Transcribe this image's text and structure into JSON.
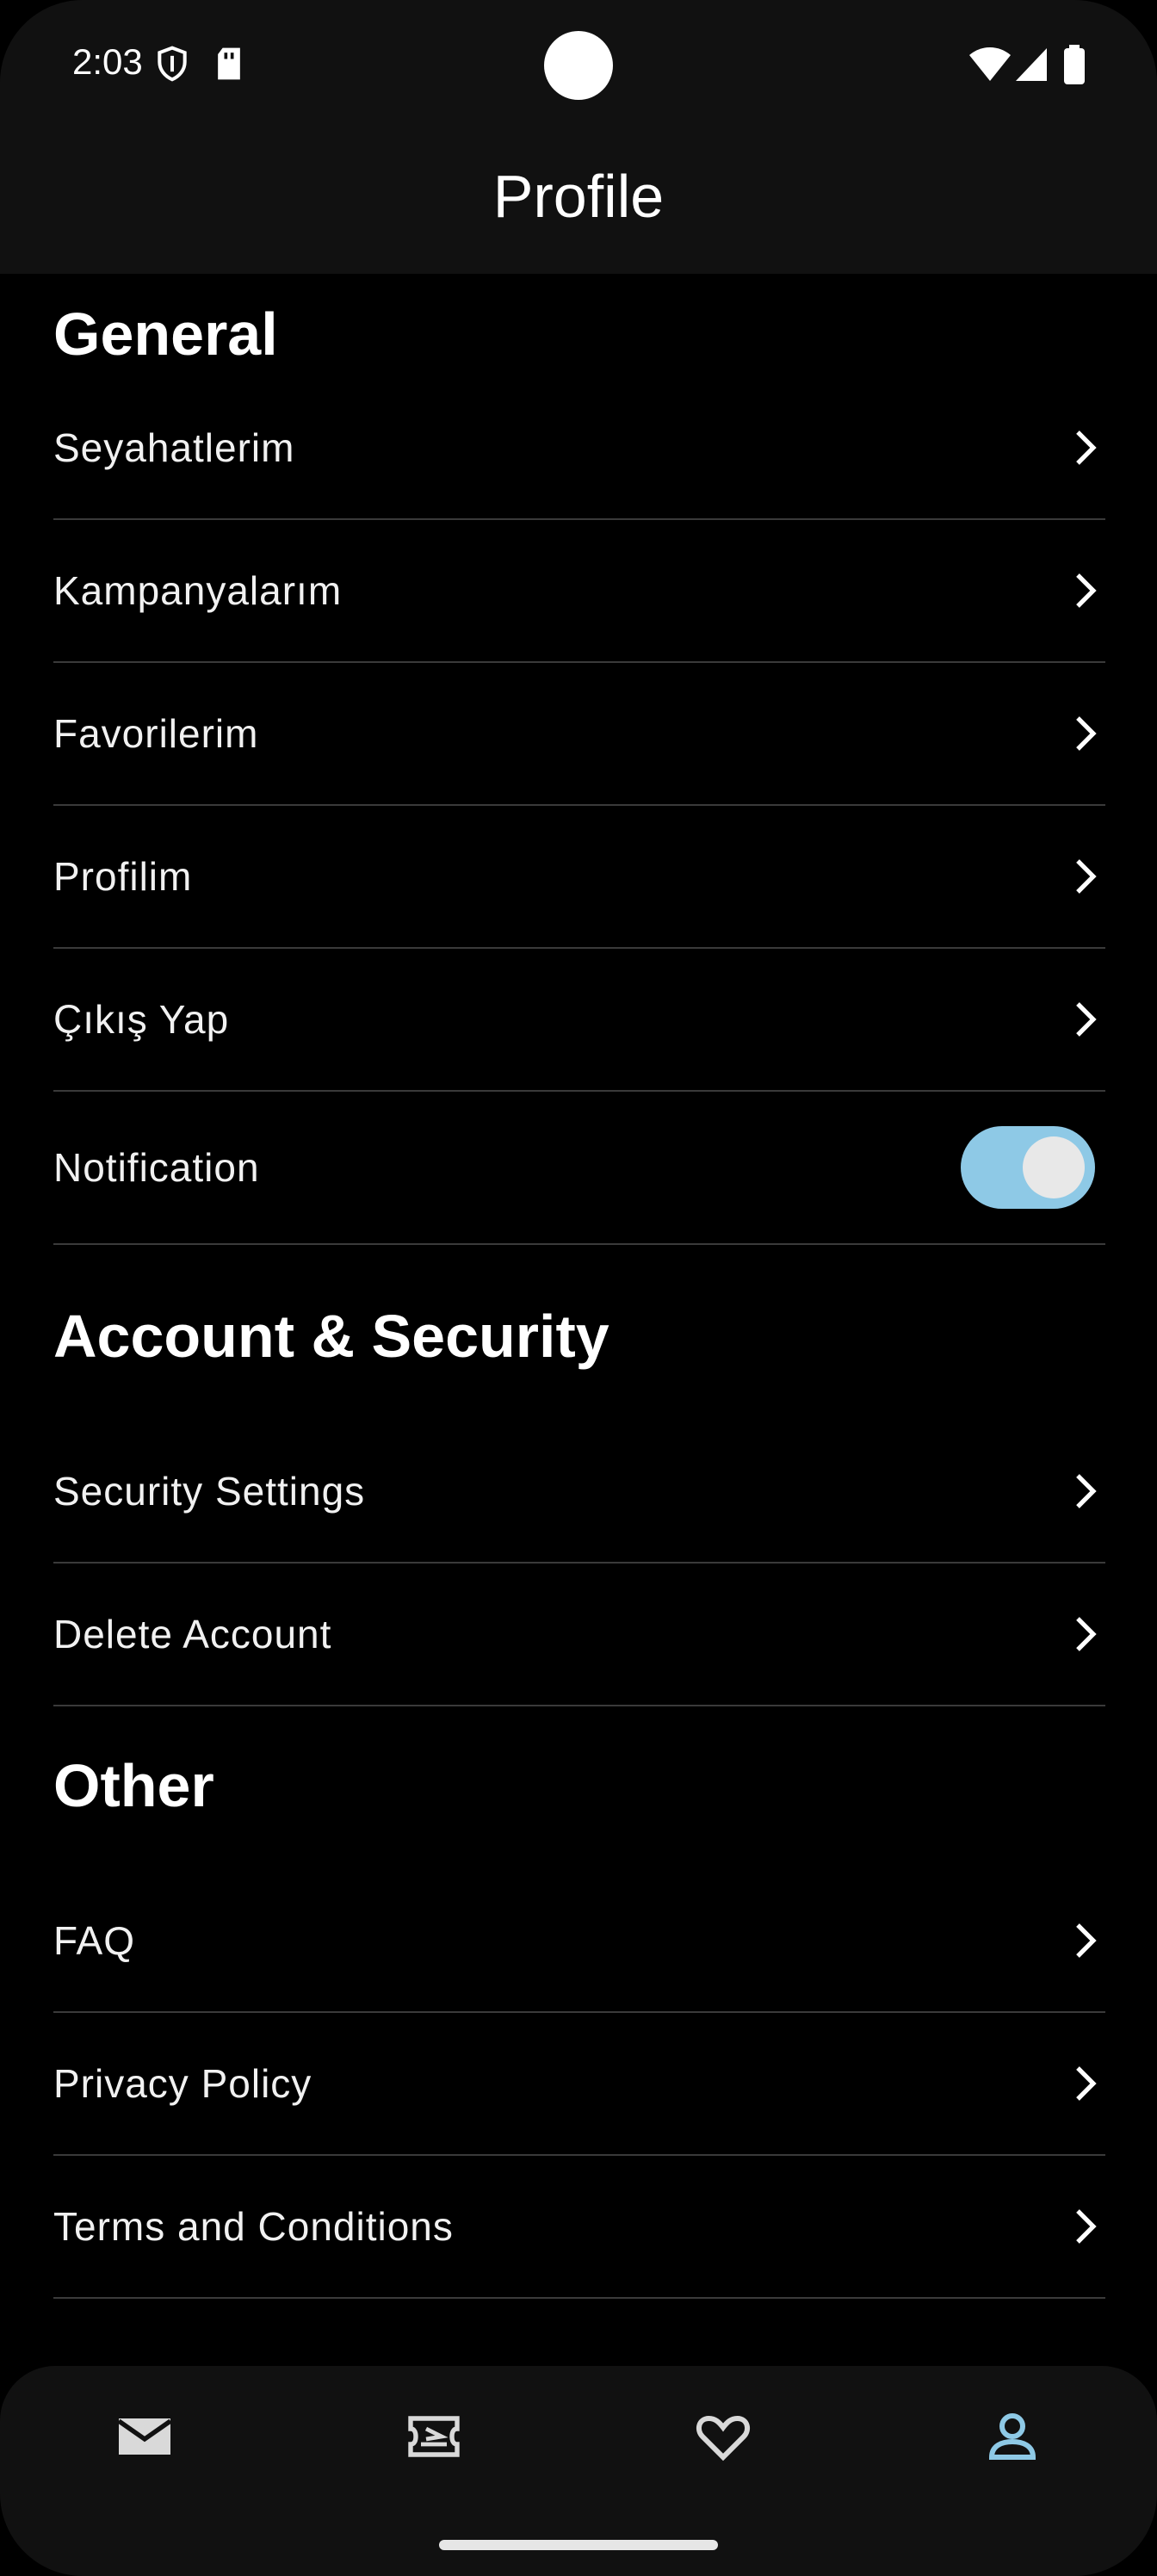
{
  "status_bar": {
    "time": "2:03",
    "icons": [
      "shield-icon",
      "sd-card-icon",
      "wifi-icon",
      "signal-icon",
      "battery-icon"
    ]
  },
  "app_bar": {
    "title": "Profile"
  },
  "sections": {
    "general": {
      "title": "General",
      "items": [
        "Seyahatlerim",
        "Kampanyalarım",
        "Favorilerim",
        "Profilim",
        "Çıkış Yap"
      ],
      "notification_label": "Notification",
      "notification_on": true
    },
    "account": {
      "title": "Account & Security",
      "items": [
        "Security Settings",
        "Delete Account"
      ]
    },
    "other": {
      "title": "Other",
      "items": [
        "FAQ",
        "Privacy Policy",
        "Terms and Conditions"
      ]
    }
  },
  "bottom_nav": {
    "items": [
      "mail-icon",
      "ticket-icon",
      "heart-icon",
      "person-icon"
    ],
    "active": "person-icon",
    "active_color": "#8ec9e6",
    "inactive_color": "#d9d9d9"
  },
  "colors": {
    "background": "#000000",
    "toggle_track": "#8ec9e6",
    "toggle_knob": "#e8e8e8"
  }
}
